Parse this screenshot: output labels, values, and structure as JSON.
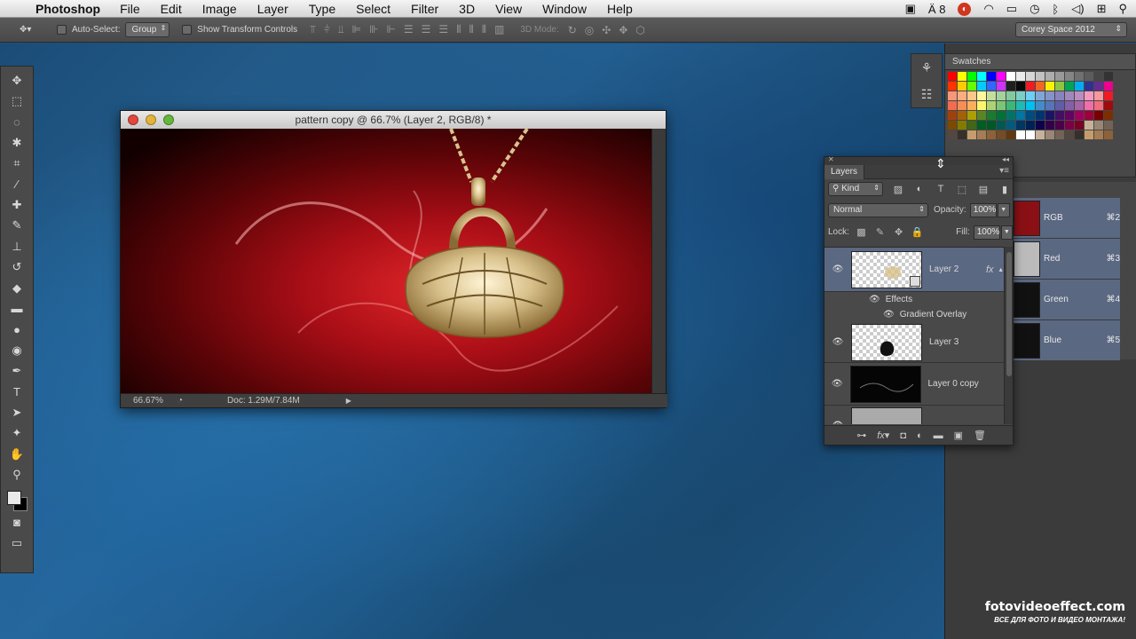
{
  "menubar": {
    "app_name": "Photoshop",
    "items": [
      "File",
      "Edit",
      "Image",
      "Layer",
      "Type",
      "Select",
      "Filter",
      "3D",
      "View",
      "Window",
      "Help"
    ],
    "status_badge": "8"
  },
  "options": {
    "auto_select_label": "Auto-Select:",
    "auto_select_value": "Group",
    "transform_label": "Show Transform Controls",
    "mode3d_label": "3D Mode:",
    "workspace": "Corey Space 2012"
  },
  "document": {
    "title": "pattern copy @ 66.7% (Layer 2, RGB/8) *",
    "zoom": "66.67%",
    "doc_size": "Doc: 1.29M/7.84M"
  },
  "swatches": {
    "tab": "Swatches",
    "colors": [
      "#ff0000",
      "#ffff00",
      "#00ff00",
      "#00ffff",
      "#0000ff",
      "#ff00ff",
      "#ffffff",
      "#ebebeb",
      "#d6d6d6",
      "#c2c2c2",
      "#adadad",
      "#999999",
      "#858585",
      "#707070",
      "#5c5c5c",
      "#474747",
      "#333333",
      "#ff3300",
      "#ffcc00",
      "#66ff00",
      "#00ccff",
      "#3366ff",
      "#cc33ff",
      "#1f1f1f",
      "#0a0a0a",
      "#ee1c24",
      "#f26522",
      "#fff200",
      "#8dc63f",
      "#00a651",
      "#00aeef",
      "#2e3192",
      "#662d91",
      "#ec008c",
      "#f7977a",
      "#f9ad81",
      "#fdc68a",
      "#fff79a",
      "#c4df9b",
      "#a3d39c",
      "#82ca9d",
      "#7bcdc8",
      "#6ecff6",
      "#7ea7d8",
      "#8493ca",
      "#8882be",
      "#a187be",
      "#bc8dbf",
      "#f49ac2",
      "#f6989d",
      "#ed1c24",
      "#f26c4f",
      "#f68e56",
      "#fbaf5d",
      "#fff568",
      "#acd373",
      "#7cc576",
      "#3bb878",
      "#1cbbb4",
      "#00bff3",
      "#438ccb",
      "#5674b9",
      "#605ca8",
      "#855fa8",
      "#a864a8",
      "#f06eaa",
      "#f26d7d",
      "#9e0b0f",
      "#a0410d",
      "#a36209",
      "#aba000",
      "#598527",
      "#1a7b30",
      "#007236",
      "#00746b",
      "#0076a3",
      "#004b80",
      "#003471",
      "#1b1464",
      "#440e62",
      "#630460",
      "#9e005d",
      "#9e0039",
      "#790000",
      "#7b2e00",
      "#7d4900",
      "#827b00",
      "#406618",
      "#005e20",
      "#005826",
      "#005952",
      "#005b7f",
      "#003663",
      "#002157",
      "#0d004c",
      "#32004b",
      "#4b0049",
      "#7b0046",
      "#7a0026",
      "#c7b299",
      "#998675",
      "#736357",
      "#534741",
      "#37302a",
      "#c69c6d",
      "#a67c52",
      "#8c6239",
      "#754c24",
      "#603913",
      "#ffffff",
      "#ffffff",
      "#c7b299",
      "#998675",
      "#736357",
      "#534741",
      "#37302a",
      "#c69c6d",
      "#a67c52",
      "#8c6239"
    ]
  },
  "channels": [
    {
      "label": "RGB",
      "shortcut": "⌘2"
    },
    {
      "label": "Red",
      "shortcut": "⌘3"
    },
    {
      "label": "Green",
      "shortcut": "⌘4"
    },
    {
      "label": "Blue",
      "shortcut": "⌘5"
    }
  ],
  "layers": {
    "tab": "Layers",
    "kind_label": "Kind",
    "blend_mode": "Normal",
    "opacity_label": "Opacity:",
    "opacity_value": "100%",
    "lock_label": "Lock:",
    "fill_label": "Fill:",
    "fill_value": "100%",
    "fx_label": "fx",
    "effects_label": "Effects",
    "gradient_label": "Gradient Overlay",
    "items": [
      {
        "name": "Layer 2"
      },
      {
        "name": "Layer 3"
      },
      {
        "name": "Layer 0 copy"
      },
      {
        "name": ""
      }
    ]
  },
  "watermark": {
    "site": "fotovideoeffect.com",
    "tagline": "ВСЕ ДЛЯ ФОТО И ВИДЕО МОНТАЖА!"
  }
}
